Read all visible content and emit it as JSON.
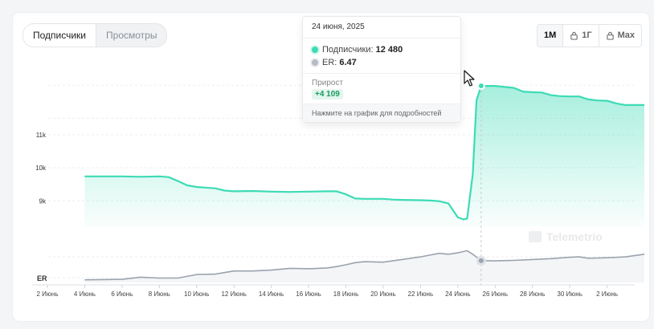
{
  "metric_tabs": [
    {
      "label": "Подписчики",
      "active": true
    },
    {
      "label": "Просмотры",
      "active": false
    }
  ],
  "range_buttons": [
    {
      "label": "1М",
      "locked": false
    },
    {
      "label": "1Г",
      "locked": true
    },
    {
      "label": "Max",
      "locked": true
    }
  ],
  "tooltip": {
    "date": "24 июня, 2025",
    "subscribers_label": "Подписчики:",
    "subscribers_value": "12 480",
    "er_label": "ER:",
    "er_value": "6.47",
    "growth_label": "Прирост",
    "growth_value": "+4 109",
    "footer": "Нажмите на график для подробностей"
  },
  "chart_data": {
    "type": "area",
    "x_ticks": [
      "2 Июнь",
      "4 Июнь",
      "6 Июнь",
      "8 Июнь",
      "10 Июнь",
      "12 Июнь",
      "14 Июнь",
      "16 Июнь",
      "18 Июнь",
      "20 Июнь",
      "22 Июнь",
      "24 Июнь",
      "26 Июнь",
      "28 Июнь",
      "30 Июнь",
      "2 Июнь"
    ],
    "y_ticks": [
      {
        "label": "9k",
        "value": 9000
      },
      {
        "label": "10k",
        "value": 10000
      },
      {
        "label": "11k",
        "value": 11000
      }
    ],
    "ylim": [
      8400,
      12700
    ],
    "er_label": "ER",
    "series": [
      {
        "name": "Подписчики",
        "color": "#3ddbb5",
        "points": [
          [
            3,
            9740
          ],
          [
            4,
            9740
          ],
          [
            5,
            9740
          ],
          [
            6,
            9730
          ],
          [
            7,
            9740
          ],
          [
            7.5,
            9720
          ],
          [
            8,
            9600
          ],
          [
            8.5,
            9470
          ],
          [
            9,
            9420
          ],
          [
            10,
            9380
          ],
          [
            10.5,
            9310
          ],
          [
            11,
            9290
          ],
          [
            12,
            9300
          ],
          [
            13,
            9280
          ],
          [
            14,
            9270
          ],
          [
            15,
            9280
          ],
          [
            16,
            9290
          ],
          [
            16.5,
            9290
          ],
          [
            17,
            9200
          ],
          [
            17.5,
            9070
          ],
          [
            18,
            9060
          ],
          [
            19,
            9060
          ],
          [
            19.5,
            9040
          ],
          [
            20,
            9030
          ],
          [
            21,
            9020
          ],
          [
            21.5,
            9010
          ],
          [
            22,
            8990
          ],
          [
            22.5,
            8920
          ],
          [
            23,
            8500
          ],
          [
            23.3,
            8440
          ],
          [
            23.5,
            8460
          ],
          [
            23.8,
            9800
          ],
          [
            24,
            12050
          ],
          [
            24.25,
            12480
          ],
          [
            25,
            12480
          ],
          [
            26,
            12420
          ],
          [
            26.5,
            12310
          ],
          [
            27,
            12290
          ],
          [
            27.5,
            12280
          ],
          [
            28,
            12200
          ],
          [
            28.5,
            12170
          ],
          [
            29,
            12160
          ],
          [
            29.5,
            12160
          ],
          [
            30,
            12070
          ],
          [
            30.5,
            12040
          ],
          [
            31,
            12030
          ],
          [
            31.5,
            11950
          ],
          [
            32,
            11900
          ],
          [
            33,
            11900
          ]
        ]
      },
      {
        "name": "ER",
        "color": "#9aa3ae",
        "points": [
          [
            3,
            4.3
          ],
          [
            5,
            4.35
          ],
          [
            6,
            4.6
          ],
          [
            7,
            4.5
          ],
          [
            8,
            4.5
          ],
          [
            9,
            4.9
          ],
          [
            10,
            4.95
          ],
          [
            11,
            5.3
          ],
          [
            12,
            5.3
          ],
          [
            13,
            5.4
          ],
          [
            14,
            5.6
          ],
          [
            15,
            5.55
          ],
          [
            16,
            5.65
          ],
          [
            16.5,
            5.8
          ],
          [
            17,
            6.0
          ],
          [
            17.5,
            6.25
          ],
          [
            18,
            6.35
          ],
          [
            19,
            6.3
          ],
          [
            20,
            6.6
          ],
          [
            21,
            6.9
          ],
          [
            21.5,
            7.1
          ],
          [
            22,
            7.3
          ],
          [
            22.5,
            7.2
          ],
          [
            23,
            7.35
          ],
          [
            23.5,
            7.6
          ],
          [
            23.8,
            7.2
          ],
          [
            24.25,
            6.47
          ],
          [
            25,
            6.45
          ],
          [
            26,
            6.5
          ],
          [
            27,
            6.6
          ],
          [
            28,
            6.7
          ],
          [
            29,
            6.85
          ],
          [
            29.5,
            6.9
          ],
          [
            30,
            6.75
          ],
          [
            31,
            6.8
          ],
          [
            32,
            6.9
          ],
          [
            33,
            7.2
          ]
        ]
      }
    ],
    "highlight_x": 24.25
  },
  "watermark": "Telemetrio"
}
